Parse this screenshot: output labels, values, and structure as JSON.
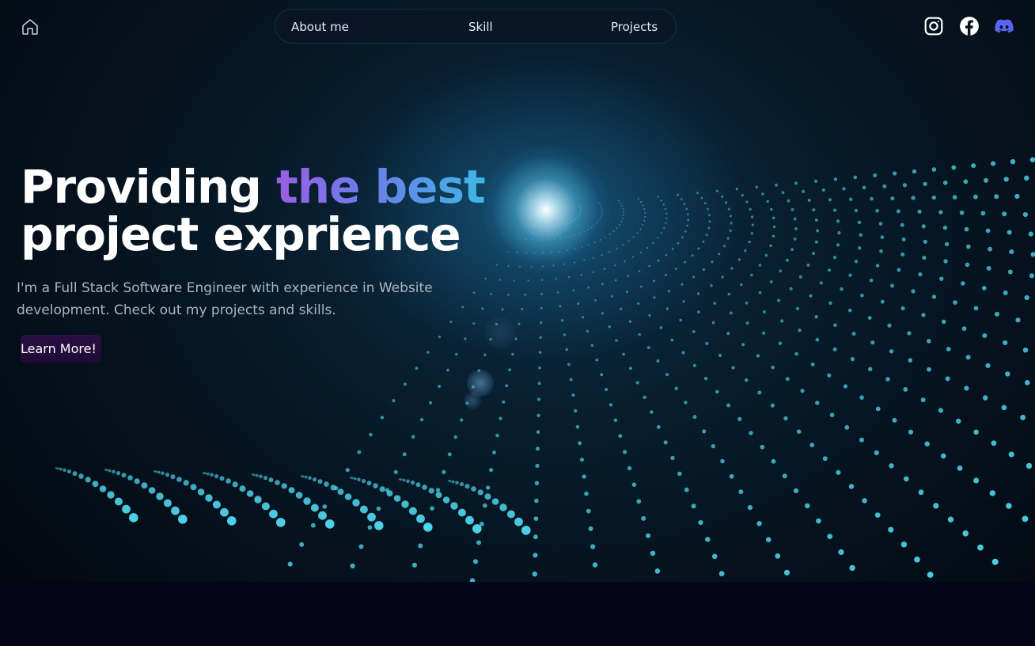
{
  "header": {
    "home_icon": "home-icon",
    "nav": [
      {
        "label": "About me"
      },
      {
        "label": "Skill"
      },
      {
        "label": "Projects"
      }
    ],
    "social": [
      {
        "icon": "instagram-icon"
      },
      {
        "icon": "facebook-icon"
      },
      {
        "icon": "discord-icon"
      }
    ]
  },
  "hero": {
    "title_part1": "Providing ",
    "title_highlight": "the best",
    "title_line2": "project exprience",
    "subtitle": "I'm a Full Stack Software Engineer with experience in Website development. Check out my projects and skills.",
    "cta_label": "Learn More!"
  },
  "colors": {
    "accent_gradient": [
      "#9b5de5",
      "#3fb7e6"
    ],
    "particles": "#4fd8f0",
    "discord": "#5865f2",
    "cta_bg": "#2a0f45",
    "background": "#06061a"
  }
}
